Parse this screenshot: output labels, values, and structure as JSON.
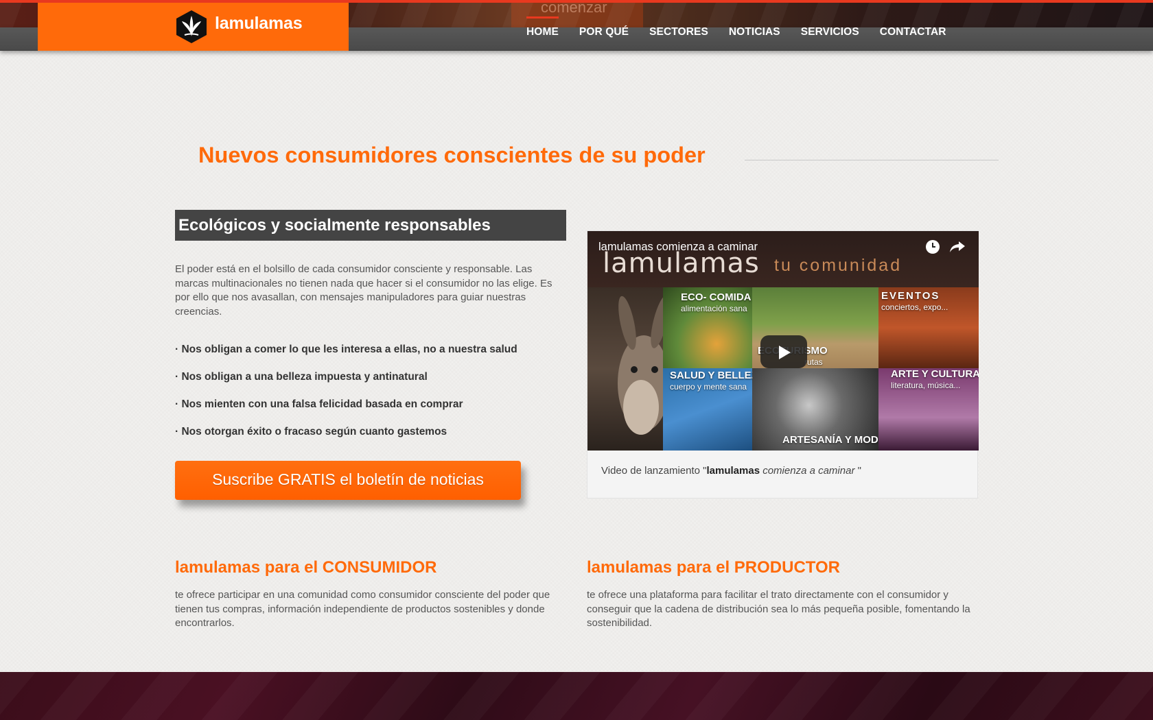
{
  "brand": {
    "name": "lamulamas"
  },
  "hero": {
    "ghost_text": "comenzar"
  },
  "nav": {
    "items": [
      "HOME",
      "POR QUÉ",
      "SECTORES",
      "NOTICIAS",
      "SERVICIOS",
      "CONTACTAR"
    ],
    "active": "HOME"
  },
  "main": {
    "title": "Nuevos consumidores conscientes de su poder",
    "subheading": "Ecológicos y socialmente responsables",
    "intro": "El poder está en el bolsillo de cada consumidor consciente y responsable. Las marcas multinacionales no tienen nada que hacer si el consumidor no las elige. Es por ello que nos avasallan, con mensajes manipuladores para guiar nuestras creencias.",
    "bullets": [
      "· Nos obligan a comer lo que les interesa a ellas, no a nuestra salud",
      "· Nos obligan a una belleza impuesta y antinatural",
      "· Nos mienten con una falsa felicidad basada en comprar",
      "· Nos otorgan éxito o fracaso según cuanto gastemos"
    ],
    "cta": "Suscribe GRATIS el boletín de noticias"
  },
  "video": {
    "title": "lamulamas comienza a caminar",
    "thumb_brand": "lamulamas",
    "thumb_tagline": "tu comunidad",
    "tiles": {
      "eco": {
        "label": "ECO- COMIDA",
        "sub": "alimentación sana"
      },
      "eventos": {
        "label": "EVENTOS",
        "sub": "conciertos, expo..."
      },
      "turismo": {
        "label": "ECOTURISMO",
        "sub": "rutas"
      },
      "salud": {
        "label": "SALUD Y BELLEZA",
        "sub": "cuerpo y mente sana"
      },
      "artesania": {
        "label": "ARTESANÍA Y MODA"
      },
      "arte": {
        "label": "ARTE Y CULTURA",
        "sub": "literatura, música..."
      }
    },
    "caption_prefix": "Video de lanzamiento \"",
    "caption_bold": "lamulamas",
    "caption_rest": " comienza a caminar",
    "caption_suffix": " \""
  },
  "columns": {
    "consumer": {
      "heading": "lamulamas para el CONSUMIDOR",
      "text": "te ofrece participar en una comunidad como consumidor consciente del poder que tienen tus compras, información independiente de productos sostenibles y donde encontrarlos."
    },
    "producer": {
      "heading": "lamulamas para el PRODUCTOR",
      "text": "te ofrece una plataforma para facilitar el trato directamente con el consumidor y conseguir que la cadena de distribución sea lo más pequeña posible, fomentando la sostenibilidad."
    }
  },
  "colors": {
    "accent": "#ff6a0a",
    "nav_bg": "#4f4f4f",
    "active_indicator": "#e8391f",
    "subheading_bg": "#444444",
    "footer_bg": "#3b0d1a"
  },
  "icons": {
    "logo": "leaf-hexagon-icon",
    "play": "play-icon",
    "watch_later": "clock-icon",
    "share": "share-icon"
  }
}
